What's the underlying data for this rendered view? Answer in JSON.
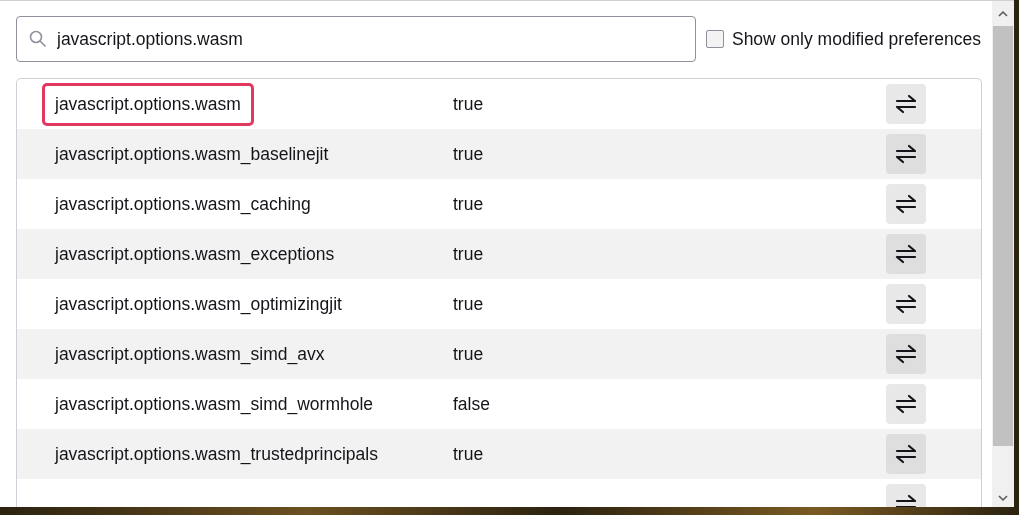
{
  "search": {
    "value": "javascript.options.wasm"
  },
  "modified_only": {
    "label": "Show only modified preferences",
    "checked": false
  },
  "preferences": [
    {
      "name": "javascript.options.wasm",
      "value": "true",
      "highlighted": true
    },
    {
      "name": "javascript.options.wasm_baselinejit",
      "value": "true",
      "highlighted": false
    },
    {
      "name": "javascript.options.wasm_caching",
      "value": "true",
      "highlighted": false
    },
    {
      "name": "javascript.options.wasm_exceptions",
      "value": "true",
      "highlighted": false
    },
    {
      "name": "javascript.options.wasm_optimizingjit",
      "value": "true",
      "highlighted": false
    },
    {
      "name": "javascript.options.wasm_simd_avx",
      "value": "true",
      "highlighted": false
    },
    {
      "name": "javascript.options.wasm_simd_wormhole",
      "value": "false",
      "highlighted": false
    },
    {
      "name": "javascript.options.wasm_trustedprincipals",
      "value": "true",
      "highlighted": false
    }
  ]
}
